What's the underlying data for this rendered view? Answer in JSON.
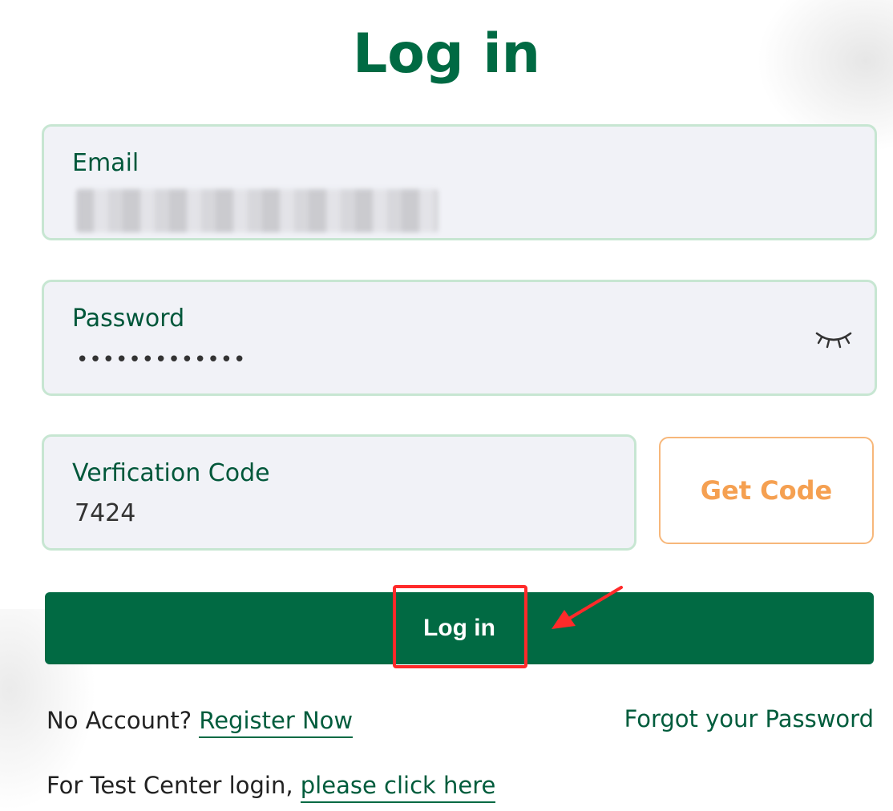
{
  "page": {
    "title": "Log in"
  },
  "form": {
    "email": {
      "label": "Email",
      "value": ""
    },
    "password": {
      "label": "Password",
      "value": "•••••••••••••",
      "toggle_icon": "eye-closed-icon"
    },
    "verification": {
      "label": "Verfication Code",
      "value": "7424",
      "get_code_label": "Get Code"
    },
    "login_button_label": "Log in"
  },
  "links": {
    "no_account_text": "No Account?",
    "register_label": "Register Now",
    "forgot_label": "Forgot your Password",
    "test_center_text": "For Test Center login,",
    "test_center_link": "please click here"
  },
  "annotations": {
    "highlight_color": "#ff2a2a"
  },
  "colors": {
    "brand_green": "#006a43",
    "field_border": "#c7e6d2",
    "field_bg": "#f1f2f7",
    "get_code_orange": "#f5a051"
  }
}
